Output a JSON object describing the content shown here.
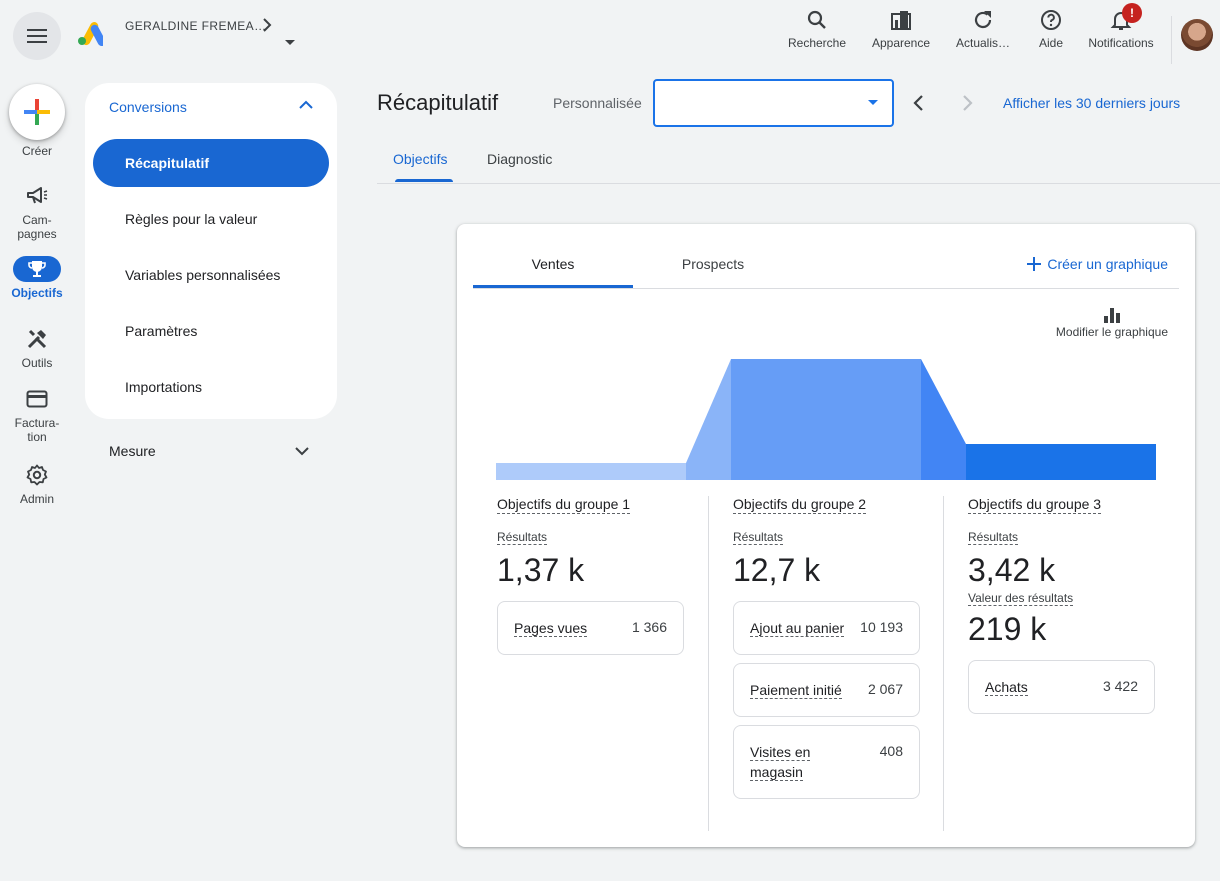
{
  "header": {
    "account_name": "GERALDINE FREMEA…",
    "actions": [
      {
        "label": "Recherche",
        "icon": "search-icon"
      },
      {
        "label": "Apparence",
        "icon": "appearance-icon"
      },
      {
        "label": "Actualis…",
        "icon": "refresh-icon"
      },
      {
        "label": "Aide",
        "icon": "help-icon"
      },
      {
        "label": "Notifications",
        "icon": "bell-icon"
      }
    ],
    "notification_badge": "!"
  },
  "rail": {
    "create_label": "Créer",
    "items": [
      {
        "label": "Cam-\npagnes",
        "icon": "megaphone-icon"
      },
      {
        "label": "Objectifs",
        "icon": "trophy-icon"
      },
      {
        "label": "Outils",
        "icon": "tools-icon"
      },
      {
        "label": "Factura-\ntion",
        "icon": "credit-card-icon"
      },
      {
        "label": "Admin",
        "icon": "gear-icon"
      }
    ]
  },
  "secondary_nav": {
    "section": "Conversions",
    "items": [
      "Récapitulatif",
      "Règles pour la valeur",
      "Variables personnalisées",
      "Paramètres",
      "Importations"
    ],
    "collapsed_section": "Mesure"
  },
  "main": {
    "title": "Récapitulatif",
    "range_label": "Personnalisée",
    "date_value": "",
    "last_30_link": "Afficher les 30 derniers jours",
    "tabs": [
      "Objectifs",
      "Diagnostic"
    ]
  },
  "card": {
    "tabs": [
      "Ventes",
      "Prospects"
    ],
    "create_chart": "Créer un graphique",
    "edit_chart": "Modifier le graphique",
    "colors": {
      "stage1": "#aecbfa",
      "stage2": "#669df6",
      "stage3": "#1a73e8"
    },
    "funnel_levels": [
      1.37,
      12.7,
      3.42
    ],
    "groups": [
      {
        "title": "Objectifs du groupe 1",
        "results_label": "Résultats",
        "results_value": "1,37 k",
        "conversions": [
          {
            "name": "Pages vues",
            "count": "1 366"
          }
        ]
      },
      {
        "title": "Objectifs du groupe 2",
        "results_label": "Résultats",
        "results_value": "12,7 k",
        "conversions": [
          {
            "name": "Ajout au panier",
            "count": "10 193"
          },
          {
            "name": "Paiement initié",
            "count": "2 067"
          },
          {
            "name": "Visites en magasin",
            "count": "408"
          }
        ]
      },
      {
        "title": "Objectifs du groupe 3",
        "results_label": "Résultats",
        "results_value": "3,42 k",
        "value_label": "Valeur des résultats",
        "value_value": "219 k",
        "conversions": [
          {
            "name": "Achats",
            "count": "3 422"
          }
        ]
      }
    ]
  }
}
